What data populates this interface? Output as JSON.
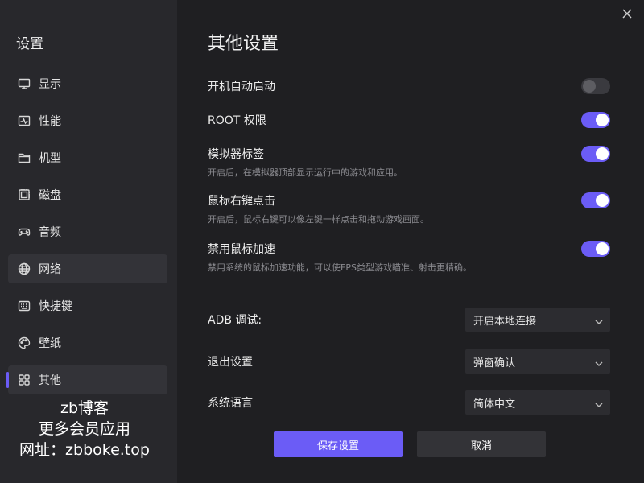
{
  "sidebar": {
    "title": "设置",
    "items": [
      {
        "label": "显示",
        "icon": "monitor-icon"
      },
      {
        "label": "性能",
        "icon": "performance-icon"
      },
      {
        "label": "机型",
        "icon": "folder-icon"
      },
      {
        "label": "磁盘",
        "icon": "disk-icon"
      },
      {
        "label": "音频",
        "icon": "gamepad-icon"
      },
      {
        "label": "网络",
        "icon": "globe-icon"
      },
      {
        "label": "快捷键",
        "icon": "keyboard-icon"
      },
      {
        "label": "壁纸",
        "icon": "palette-icon"
      },
      {
        "label": "其他",
        "icon": "grid-icon"
      }
    ],
    "active_index": 8,
    "hover_index": 5
  },
  "watermark": {
    "line1": "zb博客",
    "line2": "更多会员应用",
    "line3": "网址：zbboke.top"
  },
  "main": {
    "title": "其他设置",
    "toggles": [
      {
        "label": "开机自动启动",
        "desc": "",
        "on": false
      },
      {
        "label": "ROOT 权限",
        "desc": "",
        "on": true
      },
      {
        "label": "模拟器标签",
        "desc": "开启后，在模拟器顶部显示运行中的游戏和应用。",
        "on": true
      },
      {
        "label": "鼠标右键点击",
        "desc": "开启后，鼠标右键可以像左键一样点击和拖动游戏画面。",
        "on": true
      },
      {
        "label": "禁用鼠标加速",
        "desc": "禁用系统的鼠标加速功能，可以使FPS类型游戏瞄准、射击更精确。",
        "on": true
      }
    ],
    "selects": [
      {
        "label": "ADB 调试:",
        "value": "开启本地连接"
      },
      {
        "label": "退出设置",
        "value": "弹窗确认"
      },
      {
        "label": "系统语言",
        "value": "简体中文"
      }
    ],
    "save_label": "保存设置",
    "cancel_label": "取消"
  },
  "colors": {
    "accent": "#6b5cf6",
    "background": "#1f1f22",
    "sidebar": "#28282c"
  }
}
